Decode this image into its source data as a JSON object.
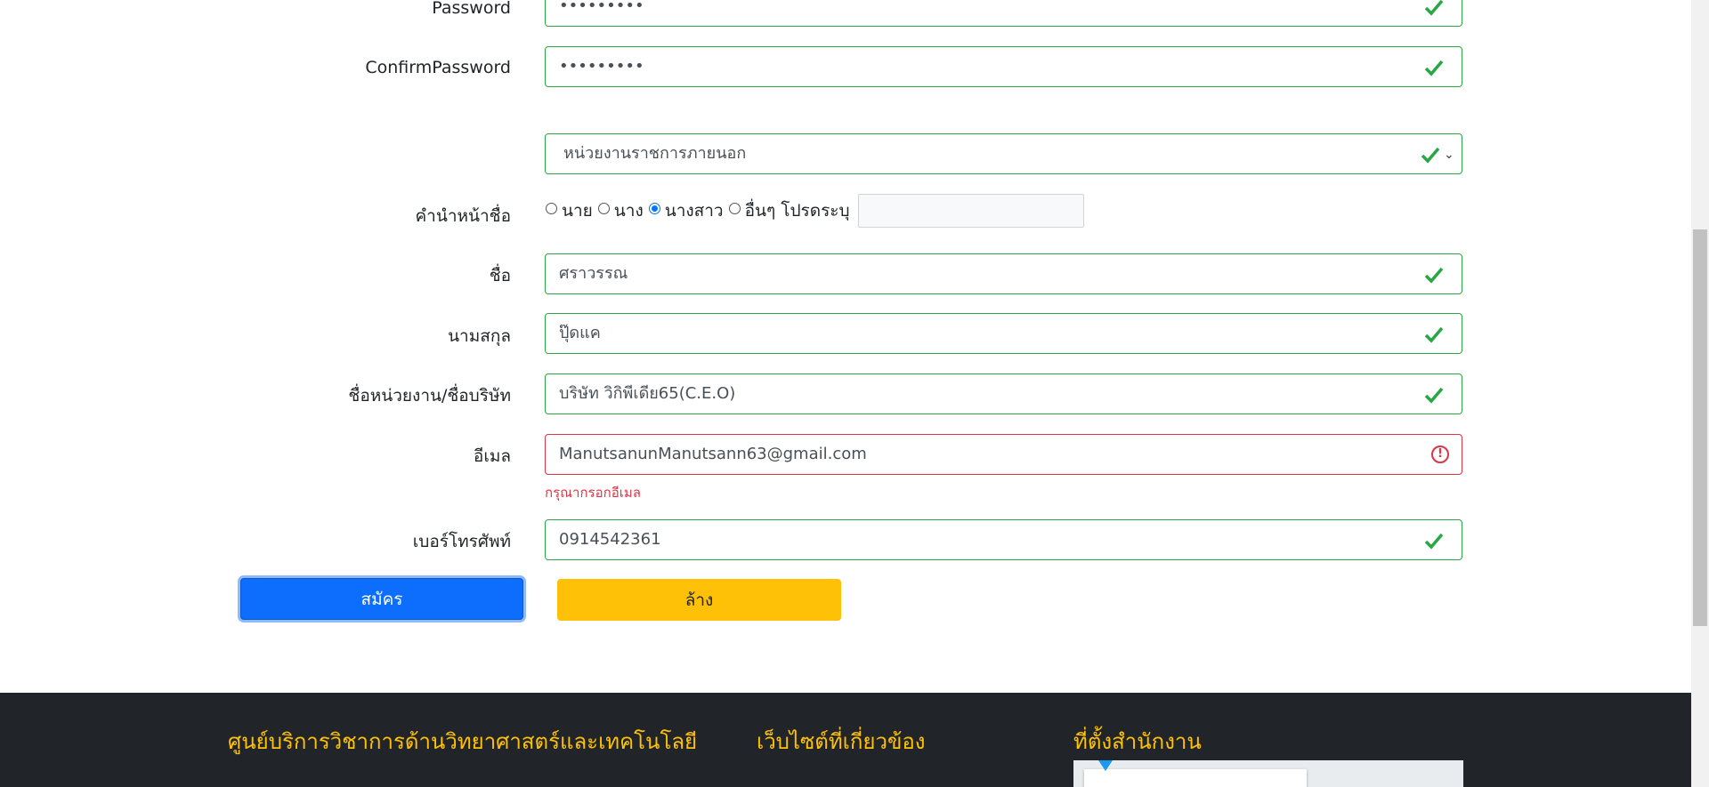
{
  "form": {
    "password": {
      "label": "Password",
      "value": "•••••••••"
    },
    "confirm_password": {
      "label": "ConfirmPassword",
      "value": "•••••••••"
    },
    "agency_type": {
      "value": "หน่วยงานราชการภายนอก"
    },
    "title_prefix": {
      "label": "คำนำหน้าชื่อ",
      "options": [
        "นาย",
        "นาง",
        "นางสาว",
        "อื่นๆ โปรดระบุ"
      ],
      "selected": "นางสาว"
    },
    "first_name": {
      "label": "ชื่อ",
      "value": "ศราวรรณ"
    },
    "last_name": {
      "label": "นามสกุล",
      "value": "ปุ๊ดแค"
    },
    "organization": {
      "label": "ชื่อหน่วยงาน/ชื่อบริษัท",
      "value": "บริษัท วิกิพีเดีย65(C.E.O)"
    },
    "email": {
      "label": "อีเมล",
      "value": "ManutsanunManutsann63@gmail.com",
      "error": "กรุณากรอกอีเมล"
    },
    "phone": {
      "label": "เบอร์โทรศัพท์",
      "value": "0914542361"
    },
    "submit_label": "สมัคร",
    "clear_label": "ล้าง"
  },
  "footer": {
    "col1_title": "ศูนย์บริการวิชาการด้านวิทยาศาสตร์และเทคโนโลยี",
    "col2_title": "เว็บไซต์ที่เกี่ยวข้อง",
    "col3_title": "ที่ตั้งสำนักงาน"
  },
  "colors": {
    "valid": "#28a745",
    "invalid": "#dc3545",
    "primary": "#0d6efd",
    "warning": "#ffc107",
    "footer_bg": "#212529",
    "footer_title": "#ffc107"
  }
}
